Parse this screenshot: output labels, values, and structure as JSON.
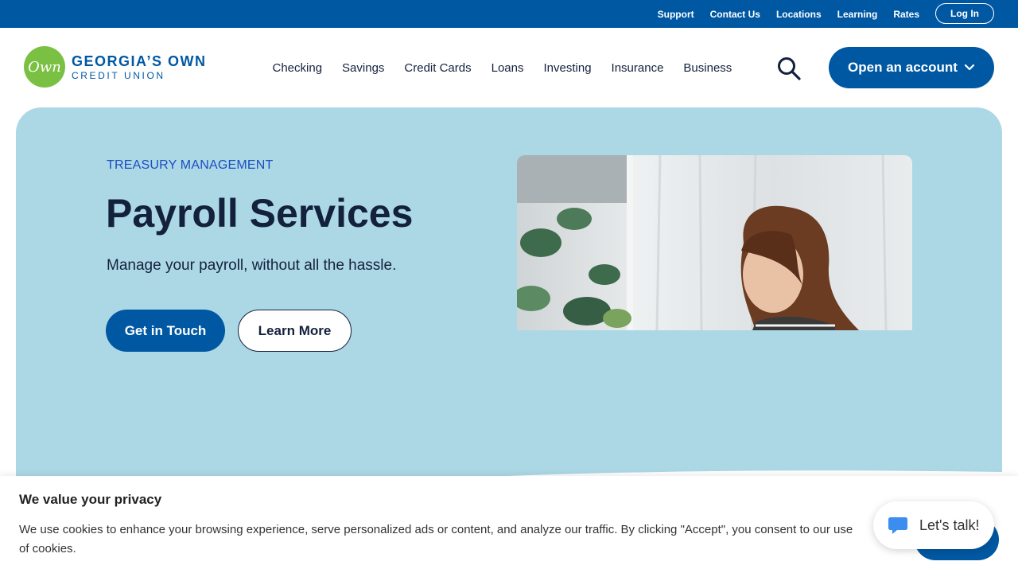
{
  "utility_bar": {
    "links": [
      "Support",
      "Contact Us",
      "Locations",
      "Learning",
      "Rates"
    ],
    "login_label": "Log In"
  },
  "logo": {
    "mark": "Own",
    "name": "GEORGIA’S OWN",
    "subname": "CREDIT UNION"
  },
  "nav": {
    "items": [
      "Checking",
      "Savings",
      "Credit Cards",
      "Loans",
      "Investing",
      "Insurance",
      "Business"
    ],
    "search_icon": "search-icon",
    "cta_label": "Open an account",
    "cta_icon": "chevron-down-icon"
  },
  "hero": {
    "eyebrow": "TREASURY MANAGEMENT",
    "title": "Payroll Services",
    "subtitle": "Manage your payroll, without all the hassle.",
    "primary_button": "Get in Touch",
    "secondary_button": "Learn More",
    "photo": "woman-working-photo"
  },
  "cookie_banner": {
    "title": "We value your privacy",
    "text": "We use cookies to enhance your browsing experience, serve personalized ads or content, and analyze our traffic. By clicking \"Accept\", you consent to our use of cookies."
  },
  "chat_widget": {
    "label": "Let's talk!",
    "icon": "chat-bubble-icon"
  },
  "colors": {
    "brand_blue": "#0058a3",
    "hero_background": "#acd8e6",
    "logo_green": "#7ac143",
    "eyebrow_blue": "#1d4ec0",
    "text_dark": "#14213d"
  }
}
